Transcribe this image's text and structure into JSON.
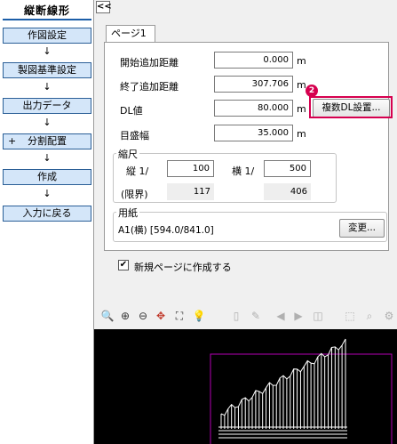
{
  "sidebar": {
    "title": "縦断線形",
    "arrow": "↓",
    "items": [
      {
        "label": "作図設定"
      },
      {
        "label": "製図基準設定"
      },
      {
        "label": "出力データ"
      },
      {
        "label": "分割配置",
        "prefix": "+"
      },
      {
        "label": "作成"
      },
      {
        "label": "入力に戻る"
      }
    ]
  },
  "collapse_label": "<<",
  "tab": {
    "label": "ページ1"
  },
  "form": {
    "start_extra_distance": {
      "label": "開始追加距離",
      "value": "0.000",
      "unit": "m"
    },
    "end_extra_distance": {
      "label": "終了追加距離",
      "value": "307.706",
      "unit": "m"
    },
    "dl_value": {
      "label": "DL値",
      "value": "80.000",
      "unit": "m",
      "button": "複数DL設置..."
    },
    "scale_interval": {
      "label": "目盛幅",
      "value": "35.000",
      "unit": "m"
    }
  },
  "scale": {
    "title": "縮尺",
    "vertical_label": "縦 1/",
    "vertical_value": "100",
    "horizontal_label": "横 1/",
    "horizontal_value": "500",
    "limit_label": "(限界)",
    "vertical_limit": "117",
    "horizontal_limit": "406"
  },
  "paper": {
    "title": "用紙",
    "value": "A1(横) [594.0/841.0]",
    "change_button": "変更..."
  },
  "new_page": {
    "label": "新規ページに作成する",
    "checked": true,
    "check_mark": "✔"
  },
  "callout_number": "2",
  "colors": {
    "accent": "#d6004f",
    "nav_fill": "#d4e6f9",
    "nav_border": "#2b5f97"
  }
}
